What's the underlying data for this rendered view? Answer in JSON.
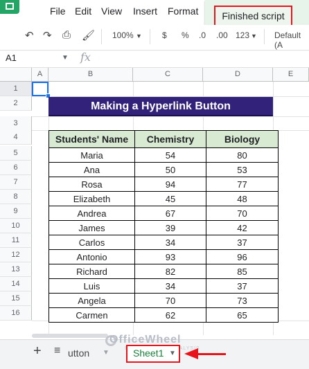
{
  "menu": [
    "File",
    "Edit",
    "View",
    "Insert",
    "Format"
  ],
  "toast": "Finished script",
  "toolbar": {
    "zoom": "100%",
    "currency": "$",
    "percent": "%",
    "dec_less": ".0",
    "dec_more": ".00",
    "more_formats": "123",
    "font": "Default (A"
  },
  "formula_bar": {
    "cell_ref": "A1",
    "fx": "fx"
  },
  "columns": [
    "A",
    "B",
    "C",
    "D",
    "E"
  ],
  "rows": [
    "1",
    "2",
    "3",
    "4",
    "5",
    "6",
    "7",
    "8",
    "9",
    "10",
    "11",
    "12",
    "13",
    "14",
    "15",
    "16"
  ],
  "title": "Making a Hyperlink Button",
  "table": {
    "headers": [
      "Students' Name",
      "Chemistry",
      "Biology"
    ],
    "rows": [
      [
        "Maria",
        "54",
        "80"
      ],
      [
        "Ana",
        "50",
        "53"
      ],
      [
        "Rosa",
        "94",
        "77"
      ],
      [
        "Elizabeth",
        "45",
        "48"
      ],
      [
        "Andrea",
        "67",
        "70"
      ],
      [
        "James",
        "39",
        "42"
      ],
      [
        "Carlos",
        "34",
        "37"
      ],
      [
        "Antonio",
        "93",
        "96"
      ],
      [
        "Richard",
        "82",
        "85"
      ],
      [
        "Luis",
        "34",
        "37"
      ],
      [
        "Angela",
        "70",
        "73"
      ],
      [
        "Carmen",
        "62",
        "65"
      ]
    ]
  },
  "tabs": {
    "add": "+",
    "list": "≡",
    "previous_tab": "utton",
    "active_tab": "Sheet1"
  },
  "watermark": {
    "brand": "OfficeWheel",
    "tagline": "EXCEL · DATA · ANALYSIS"
  },
  "colors": {
    "accent": "#1a73e8",
    "title_bg": "#33227a",
    "header_bg": "#d9ead3",
    "highlight": "#e8141b",
    "sheets_green": "#23a566"
  }
}
